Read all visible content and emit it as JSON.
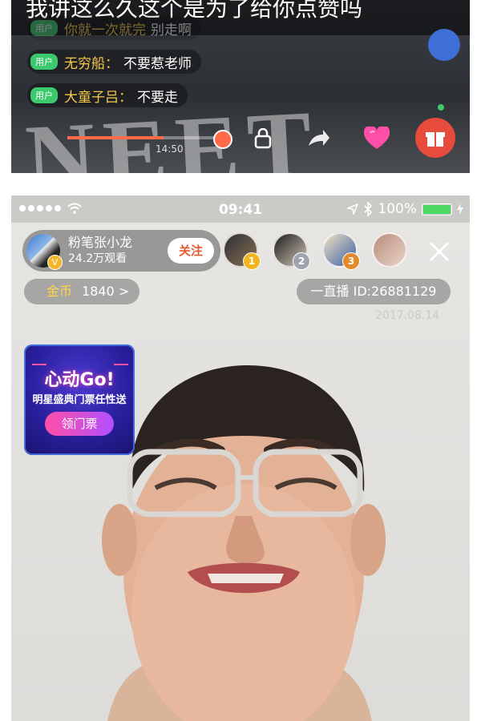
{
  "top_screenshot": {
    "caption": "我讲这么久这个是为了给你点赞吗",
    "chat": [
      {
        "badge": "用户",
        "user": "你就一次就完",
        "text": "别走啊"
      },
      {
        "badge": "用户",
        "user": "无穷船：",
        "text": "不要惹老师"
      },
      {
        "badge": "用户",
        "user": "大童子吕：",
        "text": "不要走"
      }
    ],
    "time": "14:50",
    "icons": [
      "lock-icon",
      "share-icon",
      "heart-icon",
      "gift-icon"
    ]
  },
  "live": {
    "status_bar": {
      "time": "09:41",
      "battery": "100%"
    },
    "host": {
      "name": "粉笔张小龙",
      "views": "24.2万观看",
      "follow_label": "关注",
      "badge": "V"
    },
    "viewers": [
      {
        "rank": "1",
        "rank_color": "#f2b51f"
      },
      {
        "rank": "2",
        "rank_color": "#9ea4ad"
      },
      {
        "rank": "3",
        "rank_color": "#e48a2a"
      },
      {
        "rank": "",
        "rank_color": ""
      }
    ],
    "coins": {
      "label": "金币",
      "value": "1840 >"
    },
    "room_id": "一直播 ID:26881129",
    "date": "2017.08.14",
    "promo": {
      "title": "心动Go!",
      "subtitle": "明星盛典门票任性送",
      "button": "领门票"
    }
  },
  "colors": {
    "accent": "#e7592e",
    "promo_bg": "#2a1f9e",
    "battery": "#4cd964"
  }
}
